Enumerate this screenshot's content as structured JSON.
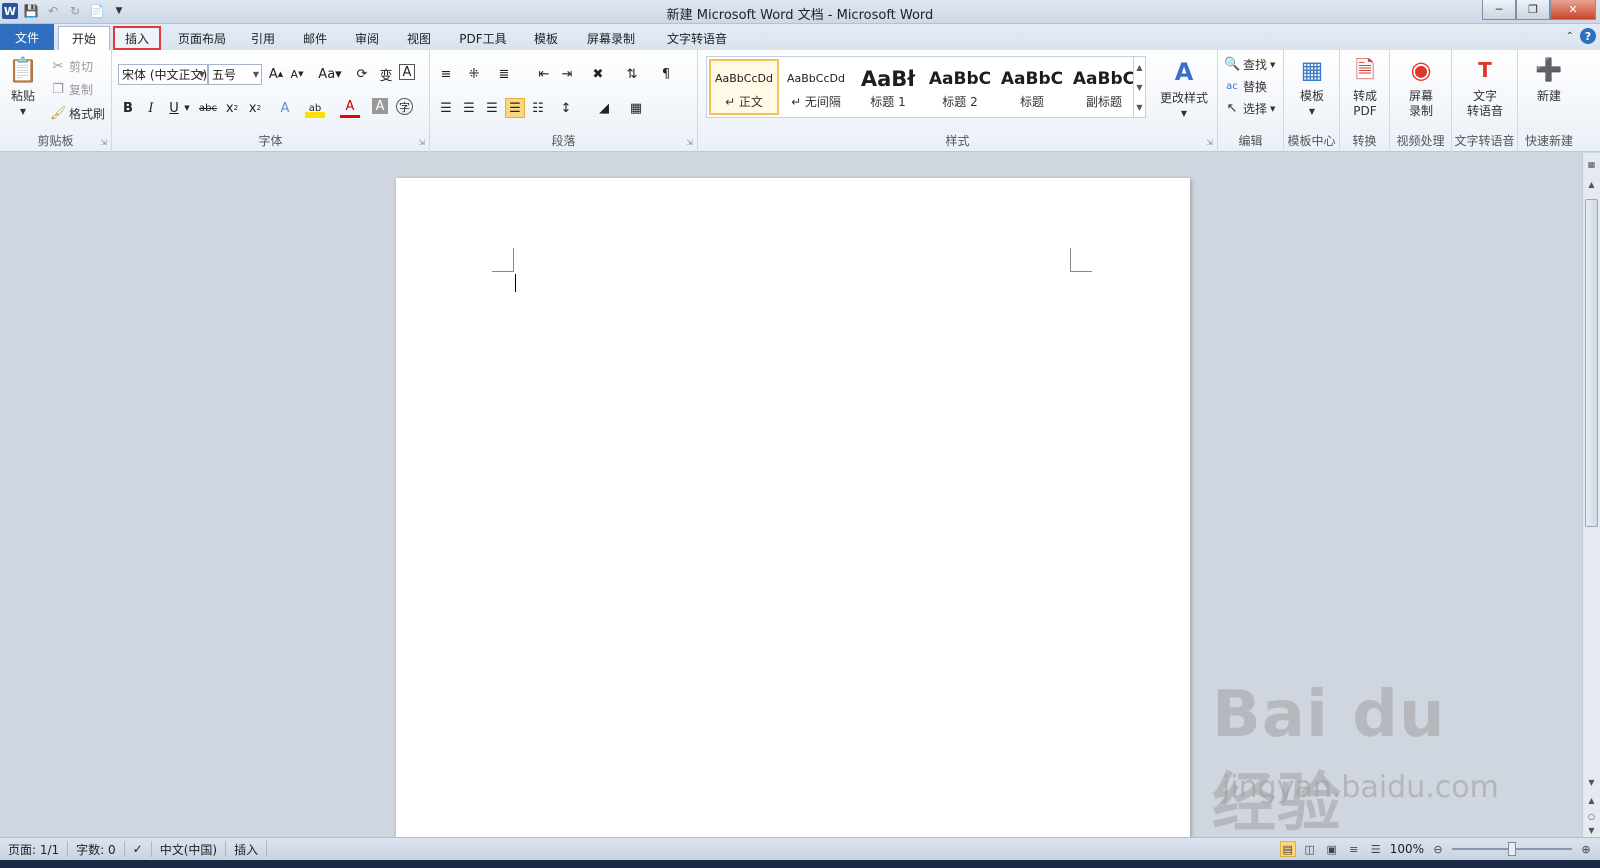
{
  "window": {
    "title": "新建 Microsoft Word 文档 - Microsoft Word",
    "logo": "W"
  },
  "tabs": [
    {
      "label": "文件"
    },
    {
      "label": "开始"
    },
    {
      "label": "插入"
    },
    {
      "label": "页面布局"
    },
    {
      "label": "引用"
    },
    {
      "label": "邮件"
    },
    {
      "label": "审阅"
    },
    {
      "label": "视图"
    },
    {
      "label": "PDF工具"
    },
    {
      "label": "模板"
    },
    {
      "label": "屏幕录制"
    },
    {
      "label": "文字转语音"
    }
  ],
  "ribbon": {
    "clipboard": {
      "label": "剪贴板",
      "paste": "粘贴",
      "cut": "剪切",
      "copy": "复制",
      "format_painter": "格式刷"
    },
    "font": {
      "label": "字体",
      "font_name": "宋体 (中文正文)",
      "font_size": "五号"
    },
    "paragraph": {
      "label": "段落"
    },
    "styles": {
      "label": "样式",
      "items": [
        {
          "preview": "AaBbCcDd",
          "name": "↵ 正文"
        },
        {
          "preview": "AaBbCcDd",
          "name": "↵ 无间隔"
        },
        {
          "preview": "AaBł",
          "name": "标题 1"
        },
        {
          "preview": "AaBbC",
          "name": "标题 2"
        },
        {
          "preview": "AaBbC",
          "name": "标题"
        },
        {
          "preview": "AaBbC",
          "name": "副标题"
        }
      ],
      "change_styles": "更改样式"
    },
    "editing": {
      "label": "编辑",
      "find": "查找",
      "replace": "替换",
      "select": "选择"
    },
    "template_center": {
      "label": "模板中心",
      "button": "模板"
    },
    "convert": {
      "label": "转换",
      "button_l1": "转成",
      "button_l2": "PDF"
    },
    "video": {
      "label": "视频处理",
      "button_l1": "屏幕",
      "button_l2": "录制"
    },
    "tts": {
      "label": "文字转语音",
      "button_l1": "文字",
      "button_l2": "转语音"
    },
    "quick_new": {
      "label": "快速新建",
      "button": "新建"
    }
  },
  "status": {
    "page": "页面: 1/1",
    "words": "字数: 0",
    "language": "中文(中国)",
    "mode": "插入",
    "zoom": "100%"
  },
  "watermark": {
    "logo": "Bai du 经验",
    "url": "jingyan.baidu.com"
  }
}
